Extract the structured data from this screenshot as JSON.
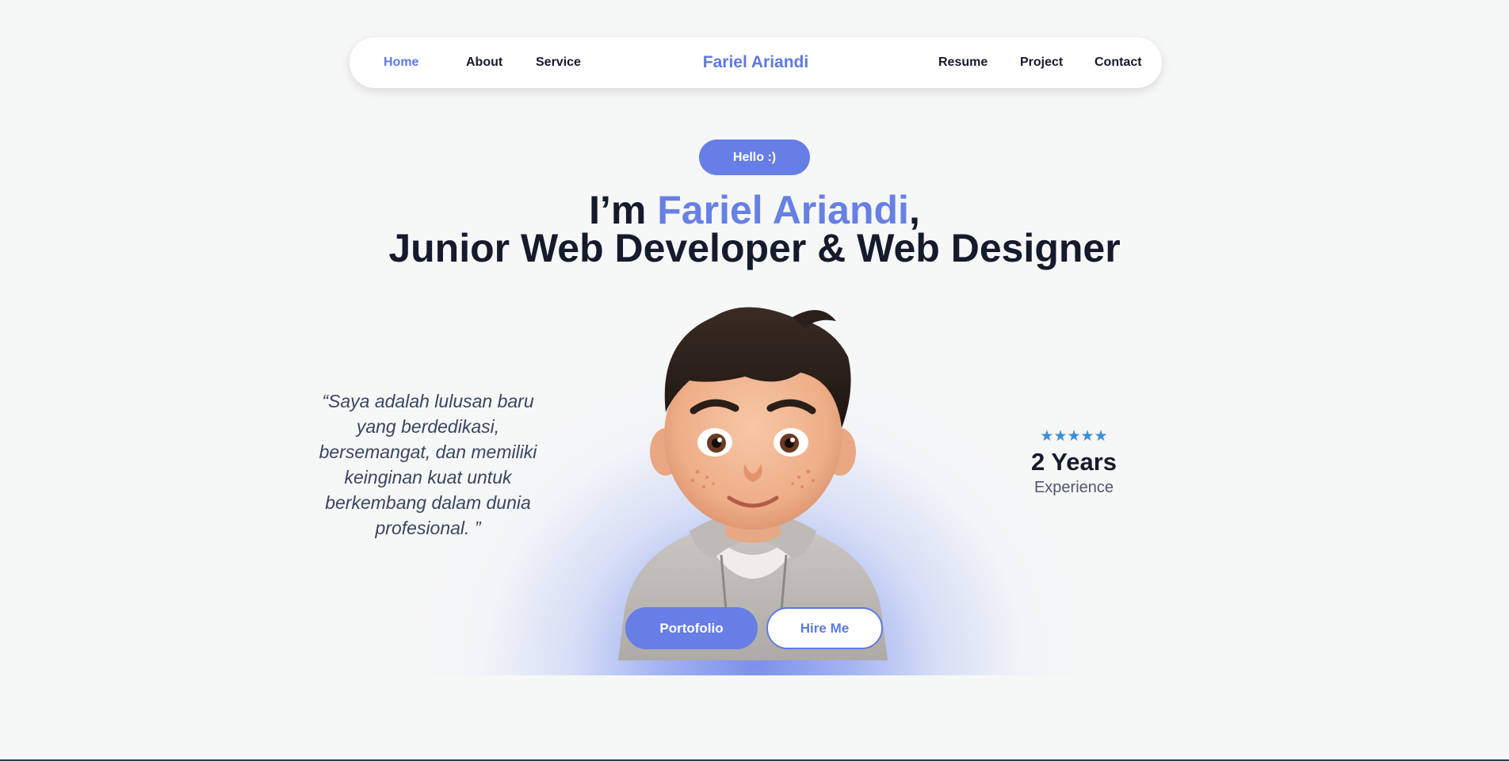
{
  "nav": {
    "home": "Home",
    "about": "About",
    "service": "Service",
    "brand": "Fariel Ariandi",
    "resume": "Resume",
    "project": "Project",
    "contact": "Contact",
    "active_color": "#5e79e2"
  },
  "hero": {
    "badge": "Hello :)",
    "headline_prefix": "I’m ",
    "headline_name": "Fariel Ariandi",
    "headline_suffix": ",",
    "headline_line2": "Junior Web Developer & Web Designer",
    "quote": "“Saya adalah lulusan baru yang berdedikasi, bersemangat, dan memiliki keinginan kuat untuk berkembang dalam dunia profesional. ”",
    "avatar_icon": "cartoon-boy-avatar",
    "accent_color": "#667ee5"
  },
  "experience": {
    "stars": "★★★★★",
    "rating": 5,
    "value": "2 Years",
    "label": "Experience"
  },
  "actions": {
    "portfolio": "Portofolio",
    "hire": "Hire Me"
  }
}
